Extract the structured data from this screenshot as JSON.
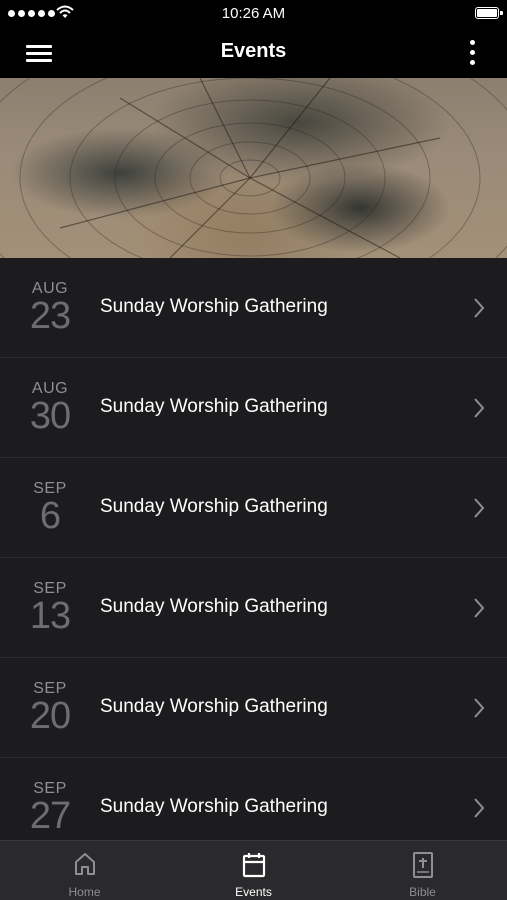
{
  "status_bar": {
    "time": "10:26 AM"
  },
  "nav": {
    "title": "Events"
  },
  "events": [
    {
      "month": "AUG",
      "day": "23",
      "title": "Sunday Worship Gathering"
    },
    {
      "month": "AUG",
      "day": "30",
      "title": "Sunday Worship Gathering"
    },
    {
      "month": "SEP",
      "day": "6",
      "title": "Sunday Worship Gathering"
    },
    {
      "month": "SEP",
      "day": "13",
      "title": "Sunday Worship Gathering"
    },
    {
      "month": "SEP",
      "day": "20",
      "title": "Sunday Worship Gathering"
    },
    {
      "month": "SEP",
      "day": "27",
      "title": "Sunday Worship Gathering"
    }
  ],
  "tabs": [
    {
      "label": "Home",
      "icon": "home-icon",
      "active": false
    },
    {
      "label": "Events",
      "icon": "calendar-icon",
      "active": true
    },
    {
      "label": "Bible",
      "icon": "bible-icon",
      "active": false
    }
  ],
  "colors": {
    "background": "#1c1c1e",
    "bar": "#000000",
    "tab_bar": "#2a2a2c",
    "text_primary": "#ffffff",
    "text_muted": "#8e8e93"
  }
}
